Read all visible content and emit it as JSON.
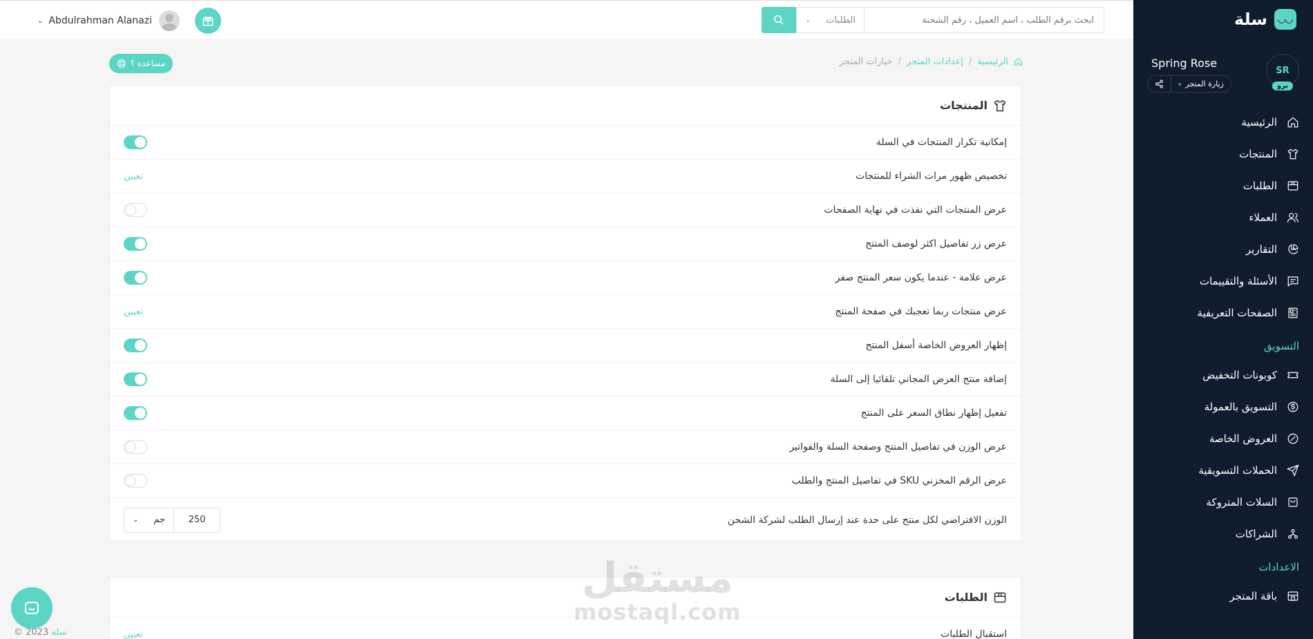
{
  "topbar": {
    "search_placeholder": "ابحث برقم الطلب ، اسم العميل ، رقم الشحنة",
    "search_scope": "الطلبات",
    "user_name": "Abdulrahman Alanazi"
  },
  "sidebar": {
    "brand": "سلة",
    "store_name": "Spring Rose",
    "store_badge": "برو",
    "store_avatar_text": "SR",
    "visit_store": "زيارة المتجر",
    "items": [
      {
        "label": "الرئيسية",
        "icon": "home-icon"
      },
      {
        "label": "المنتجات",
        "icon": "shirt-icon"
      },
      {
        "label": "الطلبات",
        "icon": "box-icon"
      },
      {
        "label": "العملاء",
        "icon": "users-icon"
      },
      {
        "label": "التقارير",
        "icon": "pie-chart-icon"
      },
      {
        "label": "الأسئلة والتقييمات",
        "icon": "comment-icon"
      },
      {
        "label": "الصفحات التعريفية",
        "icon": "newspaper-icon"
      }
    ],
    "marketing_section": "التسويق",
    "marketing_items": [
      {
        "label": "كوبونات التخفيض",
        "icon": "ticket-icon"
      },
      {
        "label": "التسويق بالعمولة",
        "icon": "dollar-icon"
      },
      {
        "label": "العروض الخاصة",
        "icon": "discount-icon"
      },
      {
        "label": "الحملات التسويقية",
        "icon": "send-icon"
      },
      {
        "label": "السلات المتروكة",
        "icon": "cart-icon"
      },
      {
        "label": "الشراكات",
        "icon": "network-icon"
      }
    ],
    "settings_section": "الاعدادات",
    "settings_items": [
      {
        "label": "باقة المتجر",
        "icon": "store-icon"
      }
    ]
  },
  "breadcrumb": {
    "home": "الرئيسية",
    "settings": "إعدادات المتجر",
    "current": "خيارات المتجر"
  },
  "help_label": "مساعدة ؟",
  "products_card": {
    "title": "المنتجات",
    "rows": [
      {
        "label": "إمكانية تكرار المنتجات في السلة",
        "type": "toggle",
        "on": true
      },
      {
        "label": "تخصيص ظهور مرات الشراء للمنتجات",
        "type": "link",
        "action": "تعيين"
      },
      {
        "label": "عرض المنتجات التي نفذت في نهاية الصفحات",
        "type": "toggle",
        "on": false
      },
      {
        "label": "عرض زر تفاصيل اكثر لوصف المنتج",
        "type": "toggle",
        "on": true
      },
      {
        "label": "عرض علامة - عندما يكون سعر المنتج صفر",
        "type": "toggle",
        "on": true
      },
      {
        "label": "عرض منتجات ربما تعجبك في صفحة المنتج",
        "type": "link",
        "action": "تعيين"
      },
      {
        "label": "إظهار العروض الخاصة أسفل المنتج",
        "type": "toggle",
        "on": true
      },
      {
        "label": "إضافة منتج العرض المجاني تلقائيا إلى السلة",
        "type": "toggle",
        "on": true
      },
      {
        "label": "تفعيل إظهار نطاق السعر على المنتج",
        "type": "toggle",
        "on": true
      },
      {
        "label": "عرض الوزن في تفاصيل المنتج وصفحة السلة والفواتير",
        "type": "toggle",
        "on": false
      },
      {
        "label": "عرض الرقم المخزني SKU في تفاصيل المنتج والطلب",
        "type": "toggle",
        "on": false
      }
    ],
    "weight_row": {
      "label": "الوزن الافتراضي لكل منتج على حدة عند إرسال الطلب لشركة الشحن",
      "value": "250",
      "unit": "جم"
    }
  },
  "orders_card": {
    "title": "الطلبات",
    "rows": [
      {
        "label": "استقبال الطلبات",
        "action": "تعيين"
      }
    ]
  },
  "footer": {
    "copyright": "2023 ©",
    "brand": "سلة"
  },
  "watermark": {
    "ar": "مستقل",
    "en": "mostaql.com"
  },
  "colors": {
    "accent": "#5dd5c4",
    "sidebar_bg": "#0f1c2e"
  }
}
